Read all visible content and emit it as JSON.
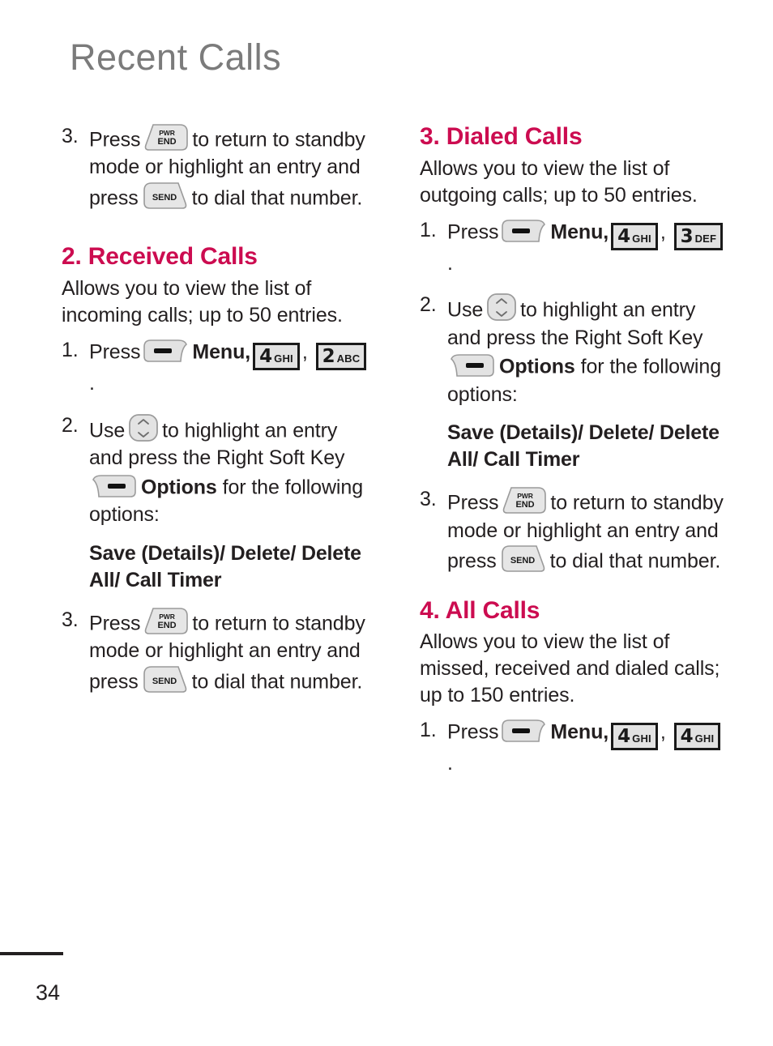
{
  "page": {
    "header_title": "Recent Calls",
    "page_number": "34",
    "accent_color": "#cc0c50",
    "header_color": "#7b7b7b",
    "text_color": "#231f20"
  },
  "keys": {
    "pwr_end": {
      "icon": "pwr-end-key-icon",
      "line1": "PWR",
      "line2": "END"
    },
    "send": {
      "icon": "send-key-icon",
      "label": "SEND"
    },
    "left_soft": {
      "icon": "left-soft-key-icon"
    },
    "right_soft": {
      "icon": "right-soft-key-icon"
    },
    "nav": {
      "icon": "navigation-key-icon"
    },
    "k2": {
      "icon": "keypad-key-2-icon",
      "digit": "2",
      "letters": "ABC"
    },
    "k3": {
      "icon": "keypad-key-3-icon",
      "digit": "3",
      "letters": "DEF"
    },
    "k4": {
      "icon": "keypad-key-4-icon",
      "digit": "4",
      "letters": "GHI"
    }
  },
  "left_column": {
    "step3_top": {
      "num": "3.",
      "t1": "Press",
      "t2": "to return to standby mode or highlight an entry and press",
      "t3": "to dial that number."
    },
    "section2": {
      "heading": "2. Received Calls",
      "description": "Allows you to view the list of incoming calls; up to 50 entries.",
      "step1": {
        "num": "1.",
        "t1": "Press",
        "t2": "Menu,",
        "sep": ",",
        "end": "."
      },
      "step2": {
        "num": "2.",
        "t1": "Use",
        "t2": "to highlight an entry and press the Right Soft Key",
        "t3": "Options",
        "t4": "for the following options:"
      },
      "options": "Save (Details)/ Delete/ Delete All/ Call Timer",
      "step3": {
        "num": "3.",
        "t1": "Press",
        "t2": "to return to standby mode or highlight an entry and press",
        "t3": "to dial that number."
      }
    }
  },
  "right_column": {
    "section3": {
      "heading": "3. Dialed Calls",
      "description": "Allows you to view the list of outgoing calls; up to 50 entries.",
      "step1": {
        "num": "1.",
        "t1": "Press",
        "t2": "Menu,",
        "sep": ",",
        "end": "."
      },
      "step2": {
        "num": "2.",
        "t1": "Use",
        "t2": "to highlight an entry and press the Right Soft Key",
        "t3": "Options",
        "t4": "for the following options:"
      },
      "options": "Save (Details)/ Delete/ Delete All/ Call Timer",
      "step3": {
        "num": "3.",
        "t1": "Press",
        "t2": "to return to standby mode or highlight an entry and press",
        "t3": "to dial that number."
      }
    },
    "section4": {
      "heading": "4. All Calls",
      "description": "Allows you to view the list of missed, received and dialed calls; up to 150 entries.",
      "step1": {
        "num": "1.",
        "t1": "Press",
        "t2": "Menu,",
        "sep": ",",
        "end": "."
      }
    }
  }
}
